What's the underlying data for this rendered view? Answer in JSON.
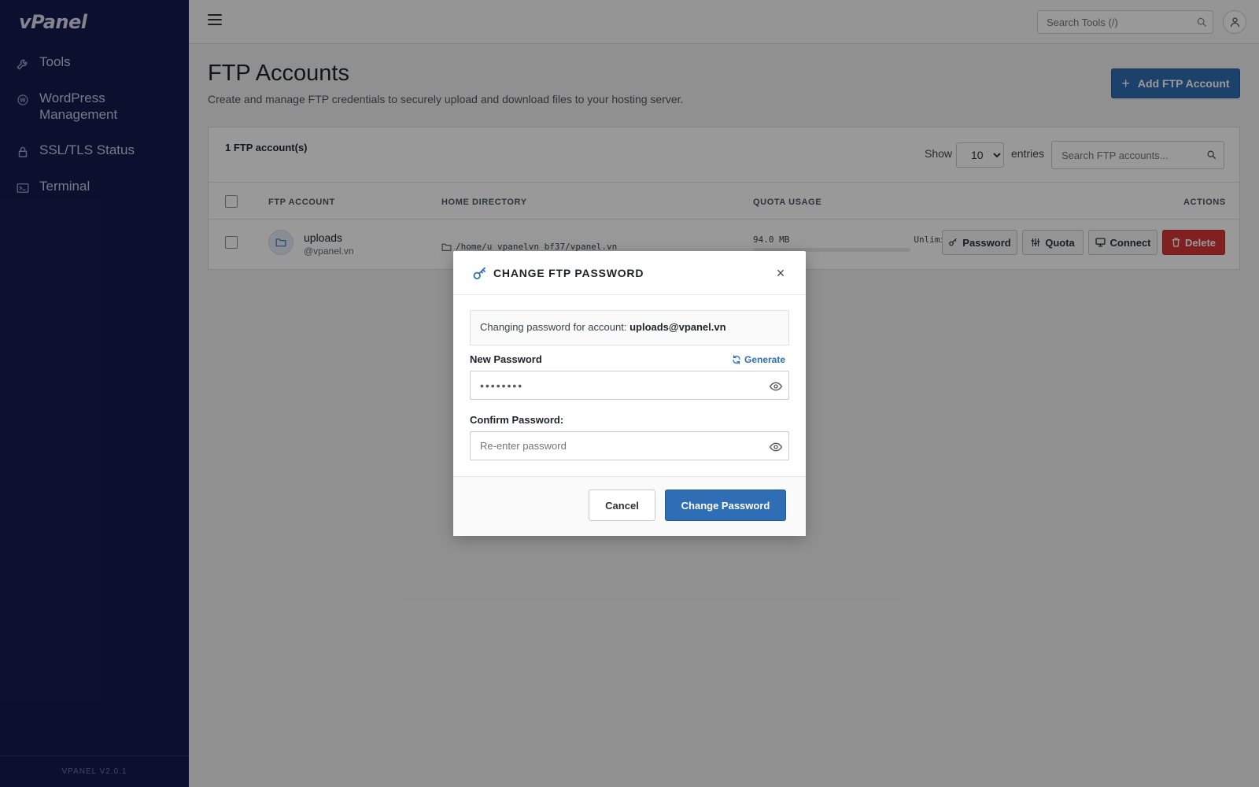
{
  "sidebar": {
    "logo": "vPanel",
    "items": [
      {
        "label": "Tools",
        "icon": "wrench-icon"
      },
      {
        "label": "WordPress Management",
        "icon": "wordpress-icon"
      },
      {
        "label": "SSL/TLS Status",
        "icon": "lock-icon"
      },
      {
        "label": "Terminal",
        "icon": "terminal-icon"
      }
    ],
    "version": "VPANEL V2.0.1"
  },
  "topbar": {
    "search_placeholder": "Search Tools (/)"
  },
  "page": {
    "title": "FTP Accounts",
    "description": "Create and manage FTP credentials to securely upload and download files to your hosting server.",
    "add_button": "Add FTP Account"
  },
  "table": {
    "count_label": "1 FTP account(s)",
    "show_label": "Show",
    "entries_value": "10",
    "entries_label": "entries",
    "search_placeholder": "Search FTP accounts...",
    "columns": [
      "FTP ACCOUNT",
      "HOME DIRECTORY",
      "QUOTA USAGE",
      "ACTIONS"
    ],
    "rows": [
      {
        "name": "uploads",
        "domain": "@vpanel.vn",
        "home_directory": "/home/u_vpanelvn_bf37/vpanel.vn",
        "quota_used": "94.0 MB",
        "quota_limit": "Unlimited",
        "quota_fraction": 0.0,
        "actions": {
          "password": "Password",
          "quota": "Quota",
          "connect": "Connect",
          "delete": "Delete"
        }
      }
    ]
  },
  "modal": {
    "title": "CHANGE FTP PASSWORD",
    "info_prefix": "Changing password for account:",
    "info_account": "uploads@vpanel.vn",
    "new_password_label": "New Password",
    "generate_label": "Generate",
    "new_password_value": "••••••••",
    "confirm_label": "Confirm Password:",
    "confirm_placeholder": "Re-enter password",
    "cancel_label": "Cancel",
    "submit_label": "Change Password"
  },
  "colors": {
    "sidebar_bg": "#161a4e",
    "primary": "#2f6eb5",
    "danger": "#d63638"
  }
}
